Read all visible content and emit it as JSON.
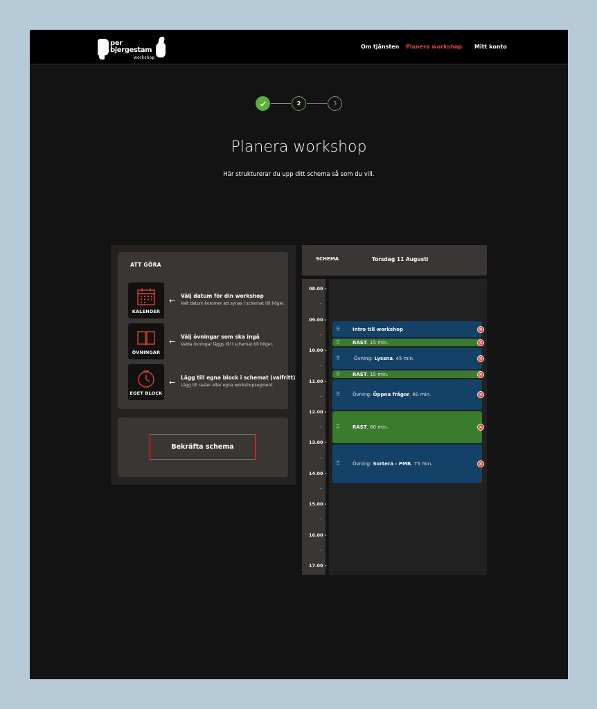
{
  "logo": {
    "line1": "per",
    "line2": "bjergestam",
    "line3": "workshop"
  },
  "nav": [
    {
      "label": "Om tjänsten"
    },
    {
      "label": "Planera workshop"
    },
    {
      "label": "Mitt konto"
    }
  ],
  "stepper": {
    "current": 2,
    "steps": [
      "✓",
      "2",
      "3"
    ]
  },
  "page": {
    "title": "Planera workshop",
    "subtitle": "Här strukturerar du upp ditt schema så som du vill."
  },
  "todo": {
    "heading": "ATT GÖRA",
    "tasks": [
      {
        "tile": "KALENDER",
        "title": "Välj datum för din workshop",
        "desc": "Valt datum kommer att synas i schemat till höger."
      },
      {
        "tile": "ÖVNINGAR",
        "title": "Välj övningar som ska ingå",
        "desc": "Valda övningar läggs till i schemat till höger."
      },
      {
        "tile": "EGET BLOCK",
        "title": "Lägg till egna block i schemat (valfritt)",
        "desc": "Lägg till raster eller egna workshopsegment"
      }
    ],
    "arrow": "←"
  },
  "confirm_label": "Bekräfta schema",
  "schedule": {
    "label": "SCHEMA",
    "date": "Torsdag 11 Augusti",
    "times": [
      "08.00 -",
      "09.00 -",
      "10.00 -",
      "11.00 -",
      "12.00 -",
      "13.00 -",
      "14.00 -",
      "15.00 -",
      "16.00 -",
      "17.00 -"
    ],
    "half_marker": "-",
    "blocks": [
      {
        "type": "blue",
        "prefix": "",
        "name": "Intro till workshop",
        "duration": ""
      },
      {
        "type": "green",
        "prefix": "",
        "name": "RAST",
        "duration": ". 15 min."
      },
      {
        "type": "blue",
        "prefix": "Övning: ",
        "name": "Lyssna",
        "duration": ". 45 min."
      },
      {
        "type": "green",
        "prefix": "",
        "name": "RAST",
        "duration": ". 15 min."
      },
      {
        "type": "blue",
        "prefix": "Övning: ",
        "name": "Öppna frågor",
        "duration": ". 60 min."
      },
      {
        "type": "green",
        "prefix": "",
        "name": "RAST",
        "duration": ". 60 min."
      },
      {
        "type": "blue",
        "prefix": "Övning: ",
        "name": "Sortera - PMR",
        "duration": ". 75 min."
      }
    ],
    "grip": "⠿",
    "remove": "×"
  },
  "colors": {
    "accent": "#e0432b",
    "green": "#5ab03a",
    "block_blue": "#134168",
    "block_green": "#3a7c2e"
  }
}
